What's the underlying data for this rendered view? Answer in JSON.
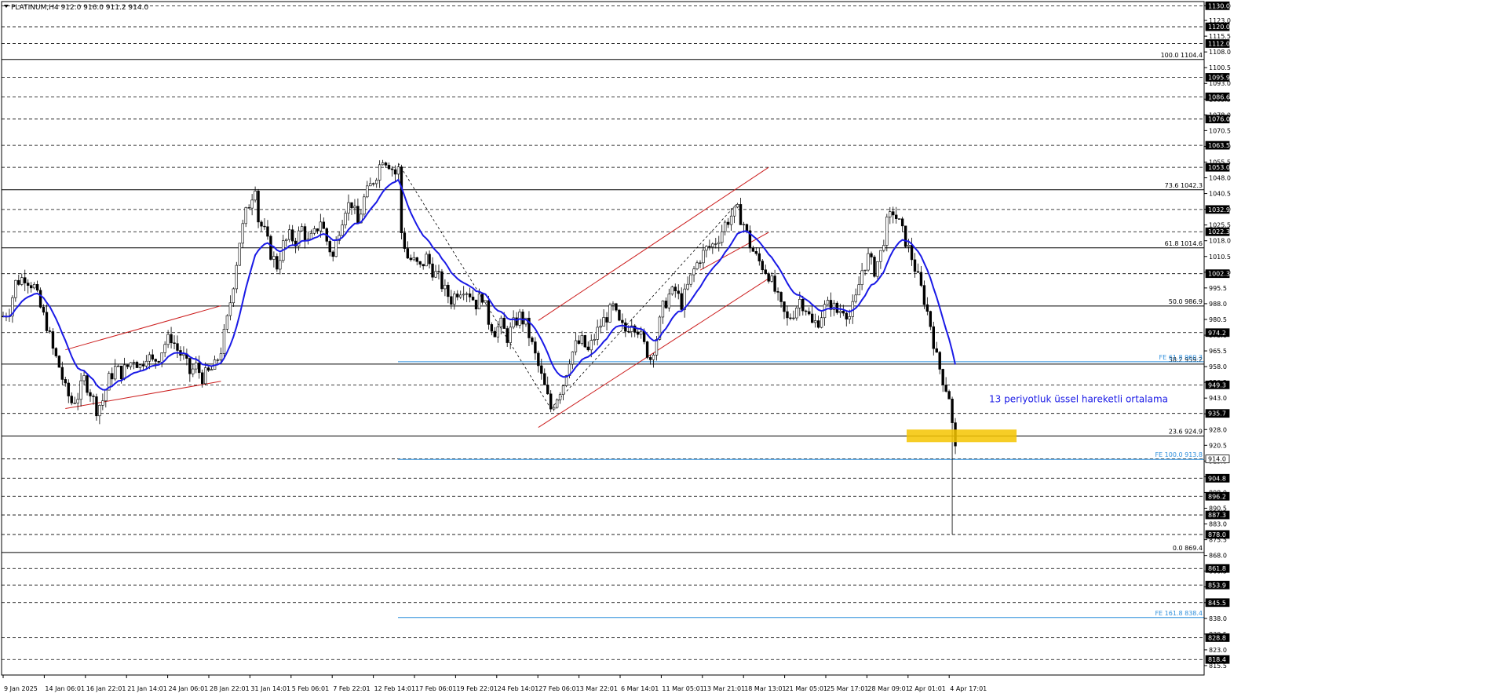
{
  "chart_data": {
    "type": "candlestick",
    "title": "PLATINUM,H4  912.0 916.0 911.2 914.0",
    "symbol": "PLATINUM",
    "timeframe": "H4",
    "ohlc_last": {
      "open": 912.0,
      "high": 916.0,
      "low": 911.2,
      "close": 914.0
    },
    "ylim": [
      811,
      1132
    ],
    "grid": "dashed horizontal levels",
    "x_ticks": [
      "9 Jan 2025",
      "14 Jan 06:01",
      "16 Jan 22:01",
      "21 Jan 14:01",
      "24 Jan 06:01",
      "28 Jan 22:01",
      "31 Jan 14:01",
      "5 Feb 06:01",
      "7 Feb 22:01",
      "12 Feb 14:01",
      "17 Feb 06:01",
      "19 Feb 22:01",
      "24 Feb 14:01",
      "27 Feb 06:01",
      "3 Mar 22:01",
      "6 Mar 14:01",
      "11 Mar 05:01",
      "13 Mar 21:01",
      "18 Mar 13:01",
      "21 Mar 05:01",
      "25 Mar 17:01",
      "28 Mar 09:01",
      "2 Apr 01:01",
      "4 Apr 17:01"
    ],
    "y_ticks": [
      1130.0,
      1123.0,
      1115.5,
      1108.0,
      1100.5,
      1093.0,
      1085.5,
      1078.0,
      1070.5,
      1063.0,
      1055.5,
      1048.0,
      1040.5,
      1033.0,
      1025.5,
      1018.0,
      1010.5,
      1003.0,
      995.5,
      988.0,
      980.5,
      973.0,
      965.5,
      958.0,
      950.5,
      943.0,
      935.5,
      928.0,
      920.5,
      913.0,
      905.5,
      898.0,
      890.5,
      883.0,
      875.5,
      868.0,
      860.5,
      853.0,
      845.5,
      838.0,
      830.5,
      823.0,
      815.5
    ],
    "price_levels": [
      1130.0,
      1120.0,
      1112.0,
      1095.9,
      1086.6,
      1076.0,
      1063.5,
      1053.0,
      1032.9,
      1022.3,
      1002.3,
      974.2,
      949.3,
      935.7,
      914.0,
      904.8,
      896.2,
      887.3,
      878.0,
      861.8,
      853.9,
      845.5,
      828.8,
      818.4
    ],
    "current_price": 914.0,
    "fibonacci_retracement": [
      {
        "label": "100.0 1104.4",
        "value": 1104.4
      },
      {
        "label": "73.6 1042.3",
        "value": 1042.3
      },
      {
        "label": "61.8 1014.6",
        "value": 1014.6
      },
      {
        "label": "50.0 986.9",
        "value": 986.9
      },
      {
        "label": "38.2 959.2",
        "value": 959.2
      },
      {
        "label": "23.6 924.9",
        "value": 924.9
      },
      {
        "label": "0.0 869.4",
        "value": 869.4
      }
    ],
    "fibonacci_expansion": [
      {
        "label": "FE 61.8 960.3",
        "value": 960.3
      },
      {
        "label": "FE 100.0 913.8",
        "value": 913.8
      },
      {
        "label": "FE 161.8 838.4",
        "value": 838.4
      }
    ],
    "annotations": [
      "13 periyotluk üssel hareketli ortalama"
    ],
    "ema_period": 13,
    "support_zone": {
      "low": 922,
      "high": 928
    },
    "price_path": [
      [
        0,
        982
      ],
      [
        2,
        985
      ],
      [
        4,
        998
      ],
      [
        7,
        1001
      ],
      [
        10,
        996
      ],
      [
        12,
        986
      ],
      [
        14,
        978
      ],
      [
        16,
        966
      ],
      [
        18,
        958
      ],
      [
        20,
        947
      ],
      [
        22,
        941
      ],
      [
        24,
        944
      ],
      [
        26,
        952
      ],
      [
        28,
        946
      ],
      [
        30,
        938
      ],
      [
        32,
        942
      ],
      [
        34,
        952
      ],
      [
        36,
        957
      ],
      [
        38,
        955
      ],
      [
        40,
        958
      ],
      [
        42,
        962
      ],
      [
        44,
        958
      ],
      [
        46,
        964
      ],
      [
        48,
        960
      ],
      [
        50,
        963
      ],
      [
        52,
        969
      ],
      [
        54,
        972
      ],
      [
        56,
        966
      ],
      [
        58,
        962
      ],
      [
        60,
        955
      ],
      [
        62,
        958
      ],
      [
        64,
        953
      ],
      [
        66,
        955
      ],
      [
        68,
        958
      ],
      [
        70,
        966
      ],
      [
        72,
        980
      ],
      [
        74,
        998
      ],
      [
        76,
        1018
      ],
      [
        78,
        1031
      ],
      [
        80,
        1040
      ],
      [
        81,
        1045
      ],
      [
        82,
        1028
      ],
      [
        84,
        1022
      ],
      [
        86,
        1012
      ],
      [
        88,
        1006
      ],
      [
        90,
        1016
      ],
      [
        92,
        1020
      ],
      [
        94,
        1018
      ],
      [
        96,
        1024
      ],
      [
        98,
        1017
      ],
      [
        100,
        1021
      ],
      [
        102,
        1028
      ],
      [
        104,
        1018
      ],
      [
        106,
        1010
      ],
      [
        108,
        1024
      ],
      [
        110,
        1034
      ],
      [
        112,
        1036
      ],
      [
        114,
        1026
      ],
      [
        116,
        1038
      ],
      [
        118,
        1044
      ],
      [
        120,
        1050
      ],
      [
        122,
        1058
      ],
      [
        124,
        1055
      ],
      [
        126,
        1050
      ],
      [
        127,
        1052
      ],
      [
        128,
        1022
      ],
      [
        130,
        1010
      ],
      [
        132,
        1008
      ],
      [
        134,
        1005
      ],
      [
        136,
        1010
      ],
      [
        138,
        1004
      ],
      [
        140,
        1000
      ],
      [
        142,
        994
      ],
      [
        144,
        990
      ],
      [
        146,
        994
      ],
      [
        148,
        996
      ],
      [
        150,
        993
      ],
      [
        152,
        988
      ],
      [
        154,
        992
      ],
      [
        156,
        980
      ],
      [
        158,
        975
      ],
      [
        160,
        978
      ],
      [
        162,
        972
      ],
      [
        164,
        978
      ],
      [
        166,
        982
      ],
      [
        168,
        978
      ],
      [
        170,
        968
      ],
      [
        172,
        958
      ],
      [
        174,
        948
      ],
      [
        176,
        938
      ],
      [
        178,
        944
      ],
      [
        180,
        950
      ],
      [
        182,
        962
      ],
      [
        184,
        968
      ],
      [
        186,
        970
      ],
      [
        188,
        965
      ],
      [
        190,
        972
      ],
      [
        192,
        978
      ],
      [
        194,
        982
      ],
      [
        196,
        986
      ],
      [
        198,
        978
      ],
      [
        200,
        975
      ],
      [
        202,
        980
      ],
      [
        204,
        976
      ],
      [
        206,
        968
      ],
      [
        208,
        962
      ],
      [
        210,
        972
      ],
      [
        212,
        986
      ],
      [
        214,
        992
      ],
      [
        216,
        994
      ],
      [
        218,
        988
      ],
      [
        220,
        996
      ],
      [
        222,
        1004
      ],
      [
        224,
        1010
      ],
      [
        226,
        1014
      ],
      [
        228,
        1016
      ],
      [
        230,
        1020
      ],
      [
        232,
        1026
      ],
      [
        234,
        1030
      ],
      [
        236,
        1032
      ],
      [
        238,
        1026
      ],
      [
        240,
        1016
      ],
      [
        242,
        1010
      ],
      [
        244,
        1006
      ],
      [
        246,
        1002
      ],
      [
        248,
        994
      ],
      [
        250,
        986
      ],
      [
        252,
        980
      ],
      [
        254,
        984
      ],
      [
        256,
        990
      ],
      [
        258,
        986
      ],
      [
        260,
        978
      ],
      [
        262,
        980
      ],
      [
        264,
        986
      ],
      [
        266,
        988
      ],
      [
        268,
        984
      ],
      [
        270,
        986
      ],
      [
        272,
        982
      ],
      [
        274,
        990
      ],
      [
        276,
        1004
      ],
      [
        278,
        1010
      ],
      [
        280,
        1004
      ],
      [
        282,
        1012
      ],
      [
        284,
        1026
      ],
      [
        286,
        1032
      ],
      [
        288,
        1026
      ],
      [
        290,
        1018
      ],
      [
        292,
        1010
      ],
      [
        294,
        1000
      ],
      [
        296,
        990
      ],
      [
        298,
        978
      ],
      [
        300,
        962
      ],
      [
        302,
        952
      ],
      [
        304,
        944
      ],
      [
        305,
        930
      ],
      [
        306,
        918
      ],
      [
        307,
        914
      ]
    ]
  }
}
